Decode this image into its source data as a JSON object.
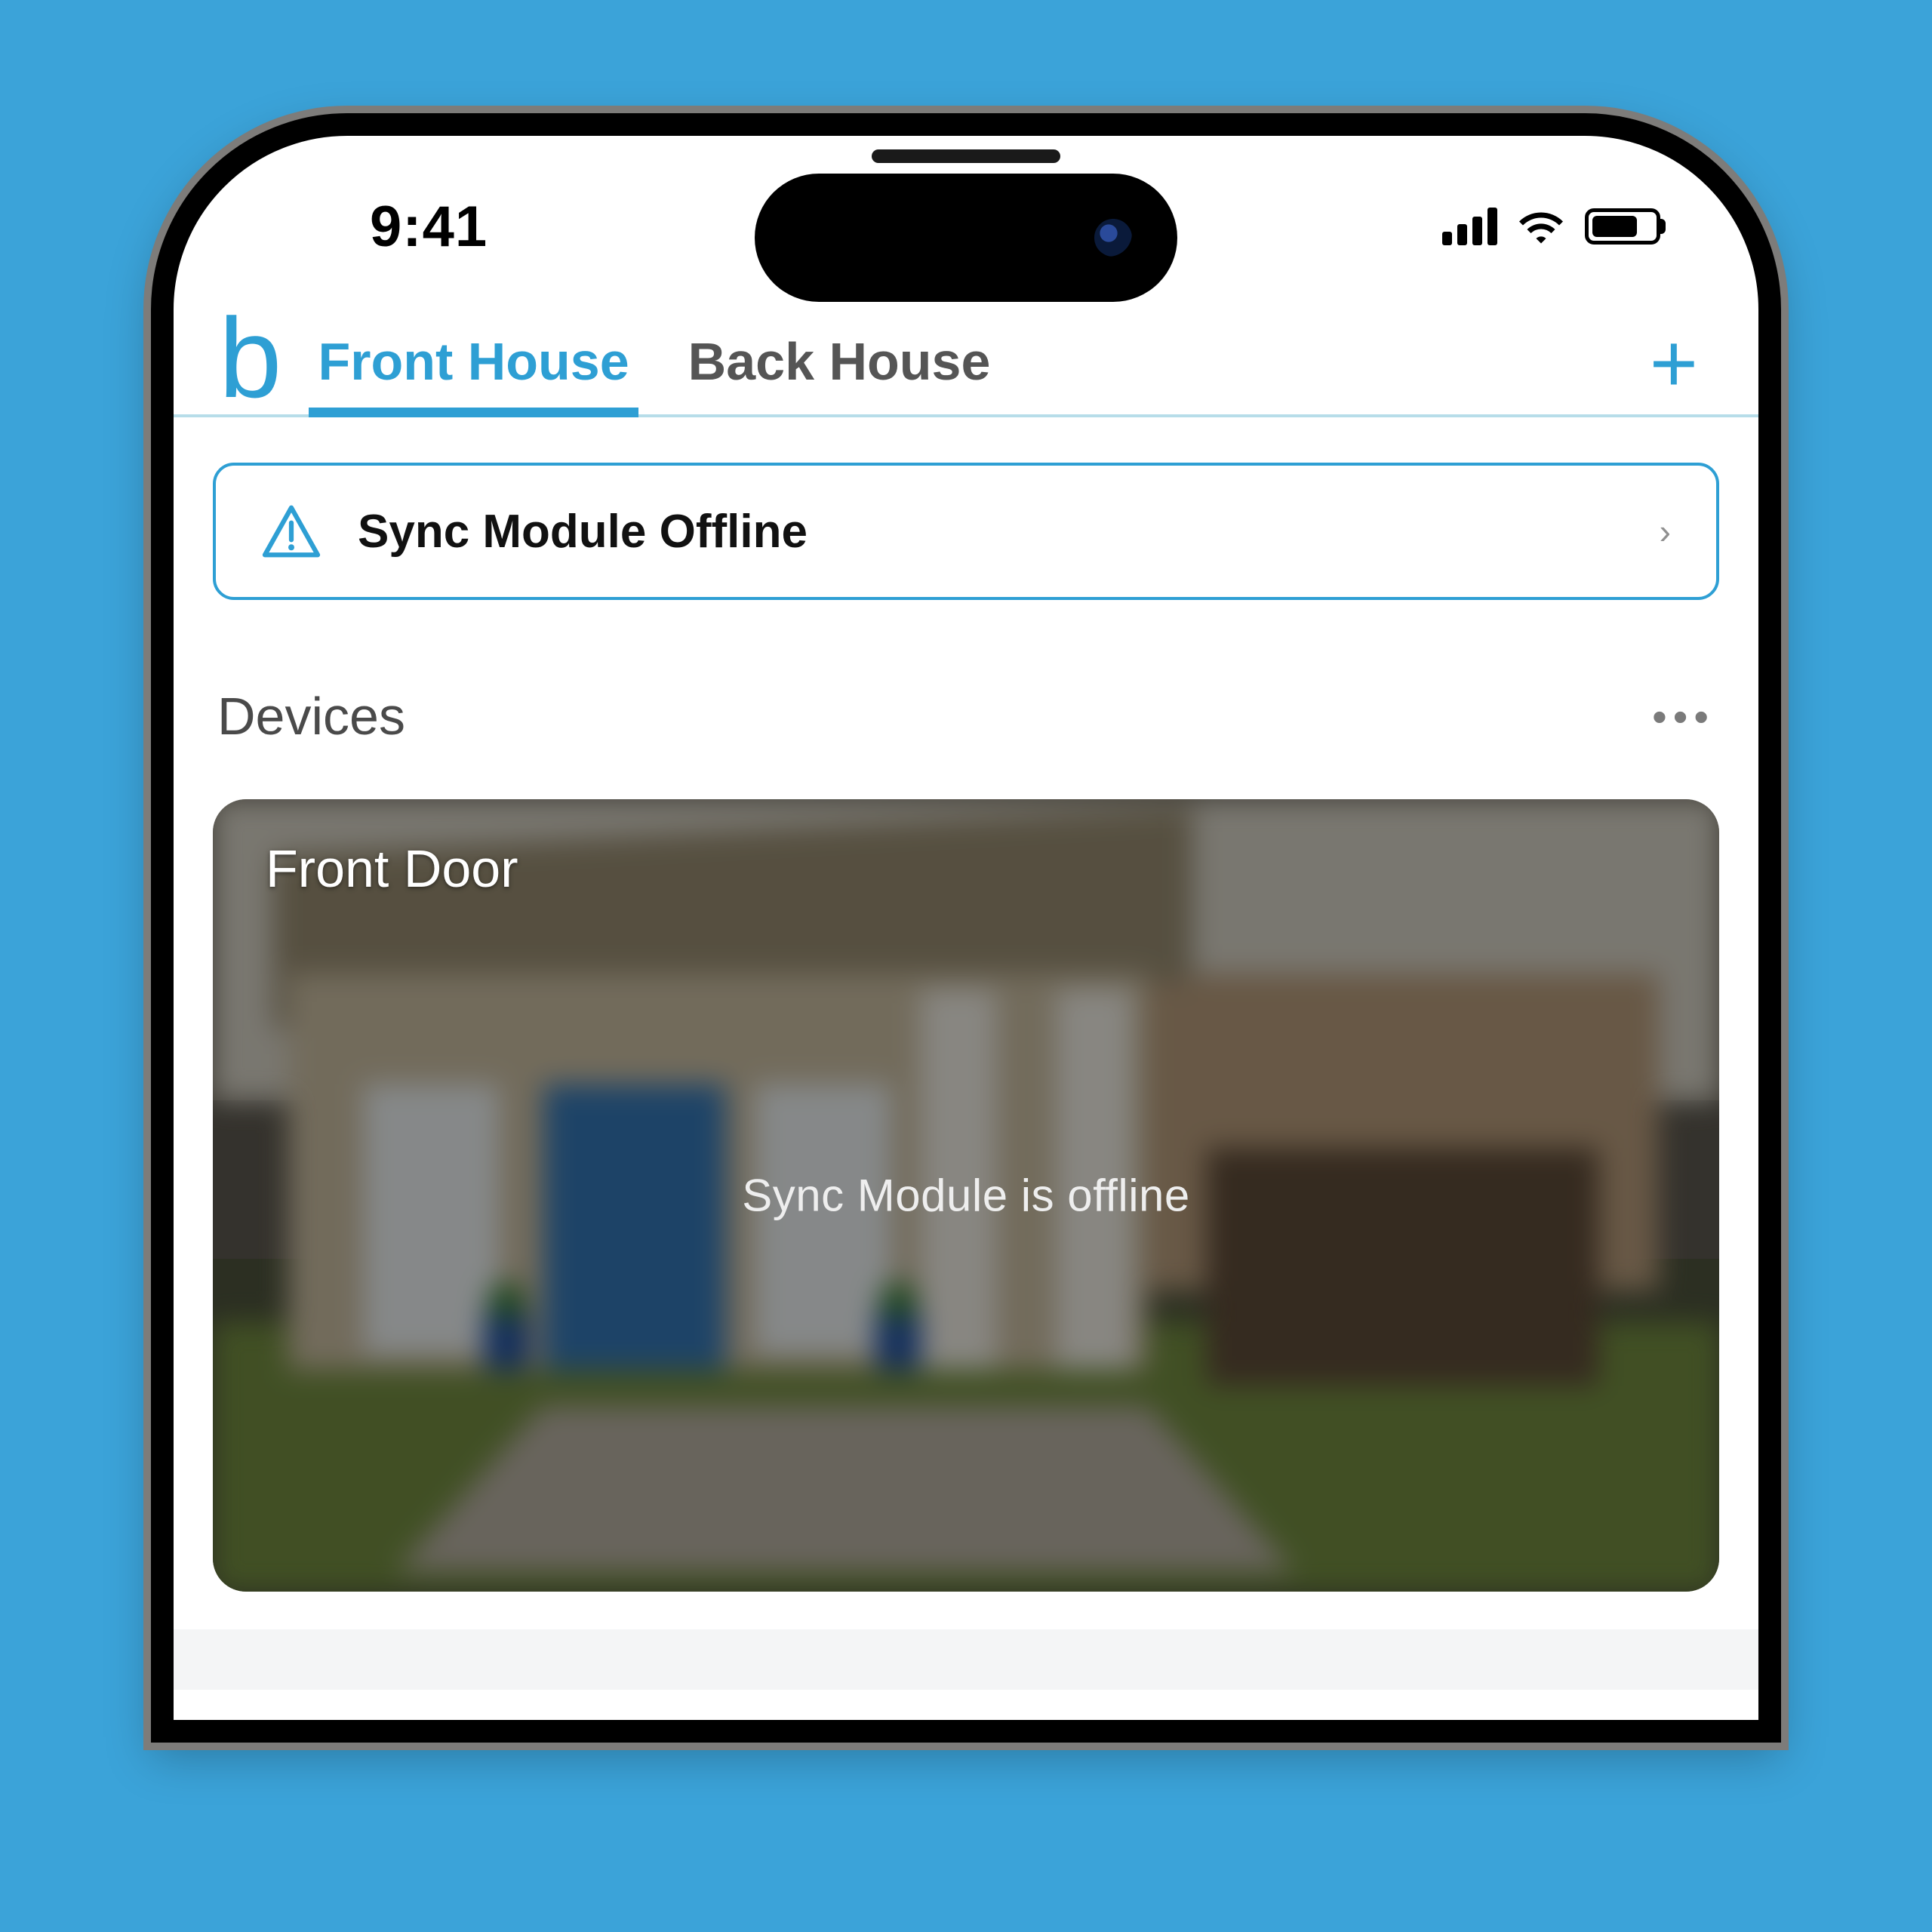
{
  "statusbar": {
    "time": "9:41"
  },
  "header": {
    "logo_glyph": "b",
    "tabs": [
      {
        "label": "Front House",
        "active": true
      },
      {
        "label": "Back House",
        "active": false
      }
    ],
    "add_glyph": "+"
  },
  "alert": {
    "text": "Sync Module Offline",
    "chevron": "›"
  },
  "devices": {
    "section_title": "Devices",
    "more_glyph": "•••",
    "cameras": [
      {
        "name": "Front Door",
        "status": "Sync Module is offline"
      }
    ]
  },
  "colors": {
    "accent": "#2e9fd4"
  }
}
